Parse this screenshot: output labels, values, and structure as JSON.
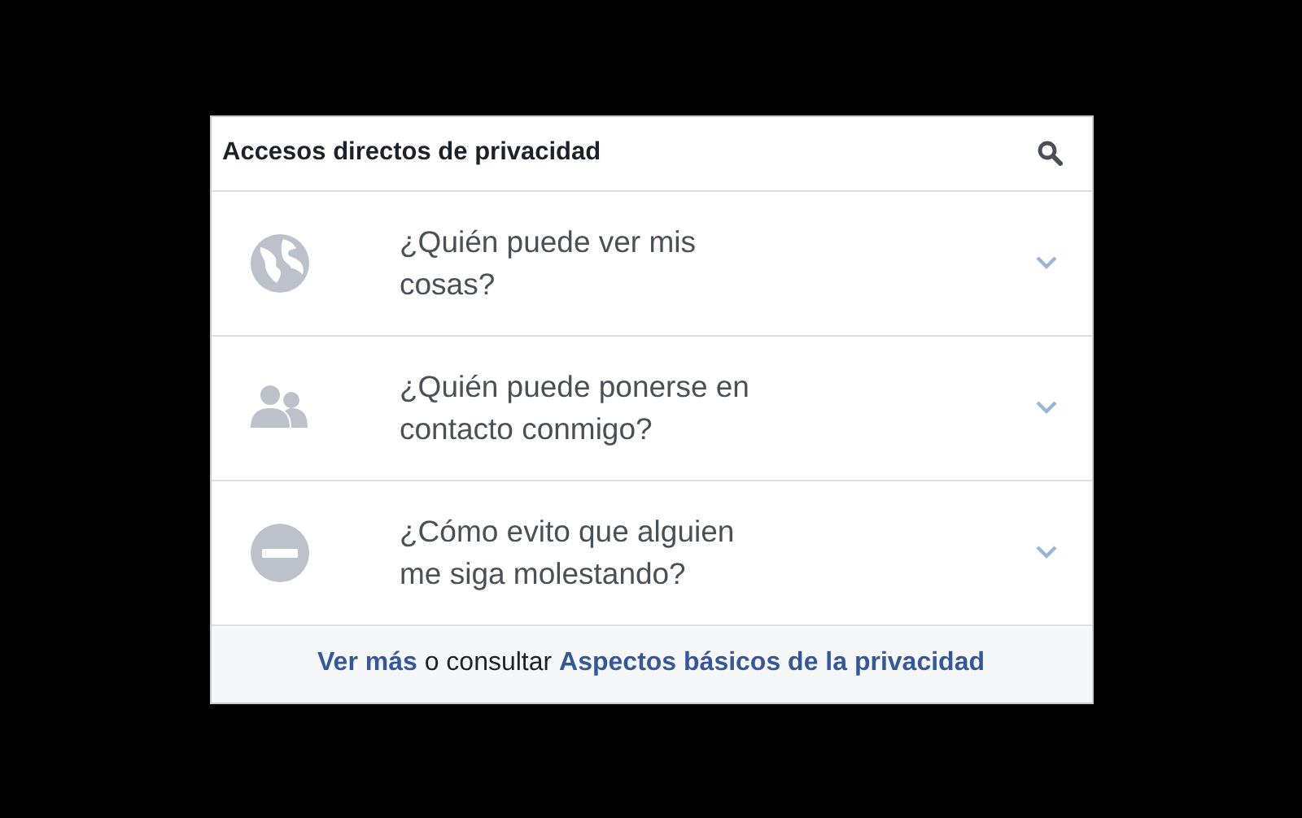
{
  "panel": {
    "title": "Accesos directos de privacidad",
    "items": [
      {
        "kind": "globe",
        "text": "¿Quién puede ver mis\ncosas?",
        "expanded": false
      },
      {
        "kind": "people",
        "text": "¿Quién puede ponerse en\ncontacto conmigo?",
        "expanded": false
      },
      {
        "kind": "block",
        "text": "¿Cómo evito que alguien\nme siga molestando?",
        "expanded": false
      }
    ],
    "footer": [
      {
        "kind": "link",
        "text": "Ver más"
      },
      {
        "kind": "text",
        "text": " o consultar "
      },
      {
        "kind": "link",
        "text": "Aspectos básicos de la privacidad"
      }
    ]
  }
}
